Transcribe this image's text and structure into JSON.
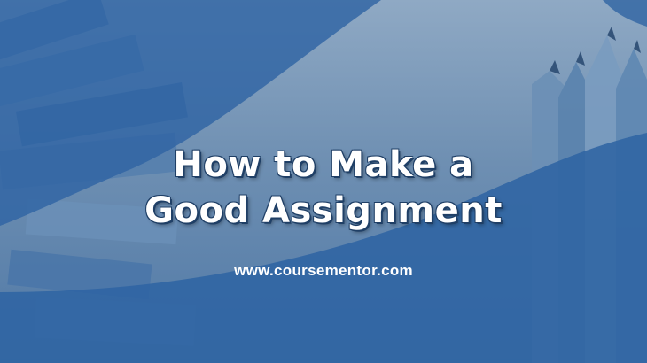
{
  "banner": {
    "title_line1": "How to Make a",
    "title_line2": "Good Assignment",
    "website": "www.coursementor.com"
  },
  "colors": {
    "primary_blue": "#2f64a3",
    "light_band": "#b8c8da",
    "text": "#ffffff"
  },
  "icons": [
    "files-stack-image",
    "pencils-image"
  ]
}
